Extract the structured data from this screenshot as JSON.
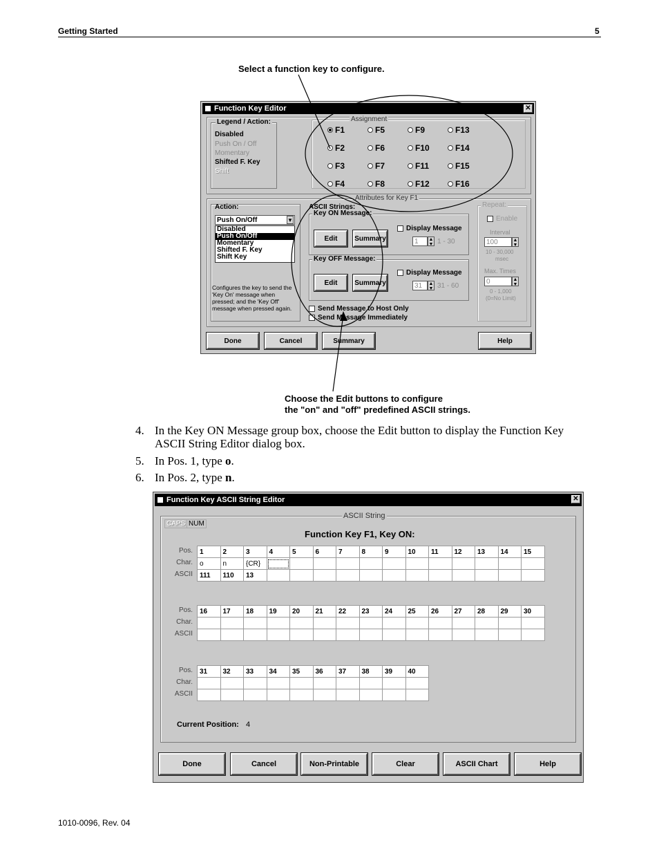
{
  "header": {
    "section": "Getting Started",
    "page": "5"
  },
  "footer": {
    "doc_id": "1010-0096, Rev. 04"
  },
  "callouts": {
    "top": "Select a function key to configure.",
    "bottom_line1": "Choose the Edit buttons to configure",
    "bottom_line2": "the \"on\" and \"off\" predefined ASCII strings."
  },
  "fke": {
    "title": "Function Key Editor",
    "legend_title": "Legend / Action:",
    "legend_items": [
      "Disabled",
      "Push On / Off",
      "Momentary",
      "Shifted F. Key",
      "Shift"
    ],
    "assignment_title": "Assignment",
    "keys": [
      "F1",
      "F5",
      "F9",
      "F13",
      "F2",
      "F6",
      "F10",
      "F14",
      "F3",
      "F7",
      "F11",
      "F15",
      "F4",
      "F8",
      "F12",
      "F16"
    ],
    "selected_key": "F1",
    "attributes_title": "Attributes for Key F1",
    "action_label": "Action:",
    "action_value": "Push On/Off",
    "action_options": [
      "Disabled",
      "Push On/Off",
      "Momentary",
      "Shifted F. Key",
      "Shift Key"
    ],
    "action_desc": "Configures the key to send the 'Key On' message when pressed; and the 'Key Off' message when pressed again.",
    "ascii_strings_label": "ASCII Strings:",
    "key_on_label": "Key ON Message:",
    "key_off_label": "Key OFF Message:",
    "edit_label": "Edit",
    "summary_label": "Summary",
    "display_message_label": "Display Message",
    "on_display_value": "1",
    "on_display_range": "1 - 30",
    "off_display_value": "31",
    "off_display_range": "31 - 60",
    "send_host_label": "Send Message to Host Only",
    "send_immediately_label": "Send Message Immediately",
    "repeat_title": "Repeat:",
    "enable_label": "Enable",
    "interval_label": "Interval",
    "interval_value": "100",
    "interval_range": "10 - 30,000",
    "interval_unit": "msec",
    "max_times_label": "Max. Times",
    "max_times_value": "0",
    "max_times_range": "0 - 1,000",
    "max_times_note": "(0=No Limit)",
    "done_label": "Done",
    "cancel_label": "Cancel",
    "summary_btn_label": "Summary",
    "help_label": "Help"
  },
  "steps": [
    {
      "num": "4.",
      "text": "In the Key ON Message group box, choose the Edit button to display the Function Key ASCII String Editor dialog box."
    },
    {
      "num": "5.",
      "text_pre": "In Pos. 1, type ",
      "text_bold": "o",
      "text_post": "."
    },
    {
      "num": "6.",
      "text_pre": "In Pos. 2, type ",
      "text_bold": "n",
      "text_post": "."
    }
  ],
  "ase": {
    "title": "Function Key ASCII String Editor",
    "caps_label": "CAPS",
    "num_label": "NUM",
    "group_title": "ASCII String",
    "heading": "Function Key F1, Key ON:",
    "row_labels": {
      "pos": "Pos.",
      "char": "Char.",
      "ascii": "ASCII"
    },
    "rows": [
      {
        "pos": [
          "1",
          "2",
          "3",
          "4",
          "5",
          "6",
          "7",
          "8",
          "9",
          "10",
          "11",
          "12",
          "13",
          "14",
          "15"
        ],
        "char": [
          "o",
          "n",
          "{CR}",
          "",
          "",
          "",
          "",
          "",
          "",
          "",
          "",
          "",
          "",
          "",
          ""
        ],
        "ascii": [
          "111",
          "110",
          "13",
          "",
          "",
          "",
          "",
          "",
          "",
          "",
          "",
          "",
          "",
          "",
          ""
        ]
      },
      {
        "pos": [
          "16",
          "17",
          "18",
          "19",
          "20",
          "21",
          "22",
          "23",
          "24",
          "25",
          "26",
          "27",
          "28",
          "29",
          "30"
        ],
        "char": [
          "",
          "",
          "",
          "",
          "",
          "",
          "",
          "",
          "",
          "",
          "",
          "",
          "",
          "",
          ""
        ],
        "ascii": [
          "",
          "",
          "",
          "",
          "",
          "",
          "",
          "",
          "",
          "",
          "",
          "",
          "",
          "",
          ""
        ]
      },
      {
        "pos": [
          "31",
          "32",
          "33",
          "34",
          "35",
          "36",
          "37",
          "38",
          "39",
          "40"
        ],
        "char": [
          "",
          "",
          "",
          "",
          "",
          "",
          "",
          "",
          "",
          ""
        ],
        "ascii": [
          "",
          "",
          "",
          "",
          "",
          "",
          "",
          "",
          "",
          ""
        ]
      }
    ],
    "current_position_label": "Current Position:",
    "current_position_value": "4",
    "buttons": [
      "Done",
      "Cancel",
      "Non-Printable",
      "Clear",
      "ASCII Chart",
      "Help"
    ]
  }
}
